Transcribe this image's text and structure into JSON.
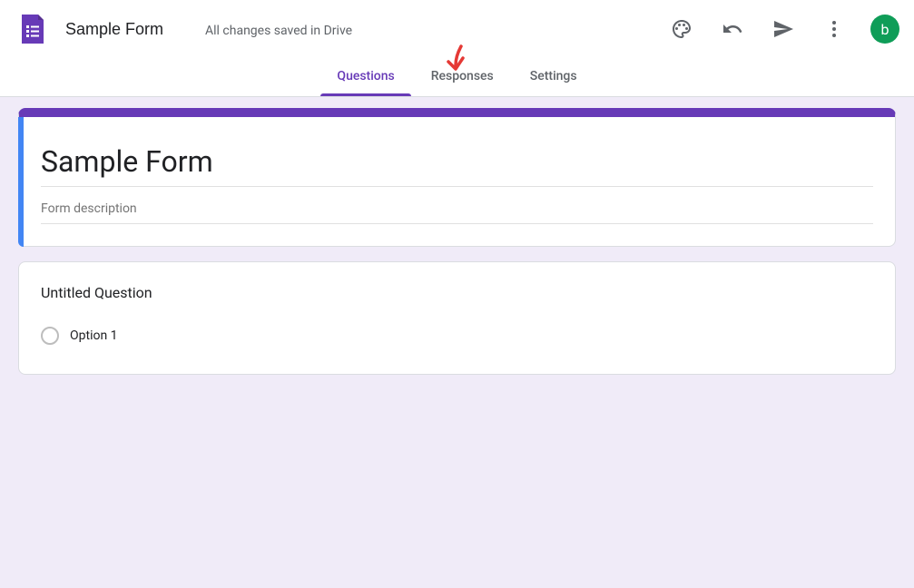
{
  "header": {
    "form_title": "Sample Form",
    "save_status": "All changes saved in Drive",
    "avatar_initial": "b"
  },
  "tabs": {
    "questions": "Questions",
    "responses": "Responses",
    "settings": "Settings"
  },
  "title_card": {
    "title": "Sample Form",
    "description_placeholder": "Form description"
  },
  "question_card": {
    "question_title": "Untitled Question",
    "option1": "Option 1"
  },
  "colors": {
    "theme": "#673ab7",
    "accent": "#4285f4",
    "avatar_bg": "#0f9d58"
  }
}
